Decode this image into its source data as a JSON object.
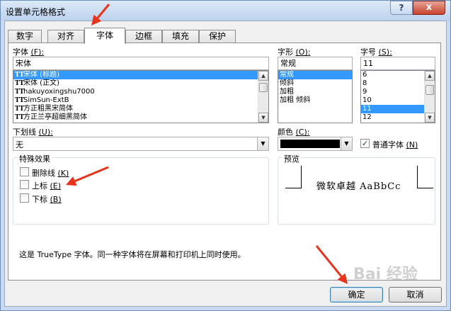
{
  "window": {
    "title": "设置单元格格式",
    "help_label": "?",
    "close_label": "x"
  },
  "tabs": [
    {
      "label": "数字"
    },
    {
      "label": "对齐"
    },
    {
      "label": "字体"
    },
    {
      "label": "边框"
    },
    {
      "label": "填充"
    },
    {
      "label": "保护"
    }
  ],
  "active_tab": "字体",
  "font": {
    "label": "字体",
    "hotkey": "(F):",
    "value": "宋体",
    "items": [
      {
        "label": "宋体 (标题)",
        "selected": true
      },
      {
        "label": "宋体 (正文)",
        "selected": false
      },
      {
        "label": "hakuyoxingshu7000",
        "selected": false
      },
      {
        "label": "SimSun-ExtB",
        "selected": false
      },
      {
        "label": "方正粗黑宋简体",
        "selected": false
      },
      {
        "label": "方正兰亭超细黑简体",
        "selected": false
      }
    ],
    "font_icon": "TT"
  },
  "style": {
    "label": "字形",
    "hotkey": "(O):",
    "value": "常规",
    "items": [
      {
        "label": "常规",
        "selected": true
      },
      {
        "label": "倾斜",
        "selected": false
      },
      {
        "label": "加粗",
        "selected": false
      },
      {
        "label": "加粗 倾斜",
        "selected": false
      }
    ]
  },
  "size": {
    "label": "字号",
    "hotkey": "(S):",
    "value": "11",
    "items": [
      {
        "label": "6",
        "selected": false
      },
      {
        "label": "8",
        "selected": false
      },
      {
        "label": "9",
        "selected": false
      },
      {
        "label": "10",
        "selected": false
      },
      {
        "label": "11",
        "selected": true
      },
      {
        "label": "12",
        "selected": false
      }
    ]
  },
  "underline": {
    "label": "下划线",
    "hotkey": "(U):",
    "value": "无"
  },
  "color": {
    "label": "颜色",
    "hotkey": "(C):",
    "swatch": "#000000"
  },
  "normal_font": {
    "label": "普通字体",
    "hotkey": "(N)",
    "checked": true,
    "check_glyph": "✓"
  },
  "effects": {
    "title": "特殊效果",
    "items": [
      {
        "label": "删除线",
        "hotkey": "(K)",
        "checked": false
      },
      {
        "label": "上标",
        "hotkey": "(E)",
        "checked": false
      },
      {
        "label": "下标",
        "hotkey": "(B)",
        "checked": false
      }
    ]
  },
  "preview": {
    "title": "预览",
    "text": "微软卓越  AaBbCc"
  },
  "note": "这是 TrueType 字体。同一种字体将在屏幕和打印机上同时使用。",
  "buttons": {
    "ok": "确定",
    "cancel": "取消"
  },
  "watermark": "Bai 经验",
  "colors": {
    "selection": "#3399ff",
    "arrow": "#e8341c"
  },
  "scroll_glyphs": {
    "up": "▲",
    "down": "▼"
  }
}
